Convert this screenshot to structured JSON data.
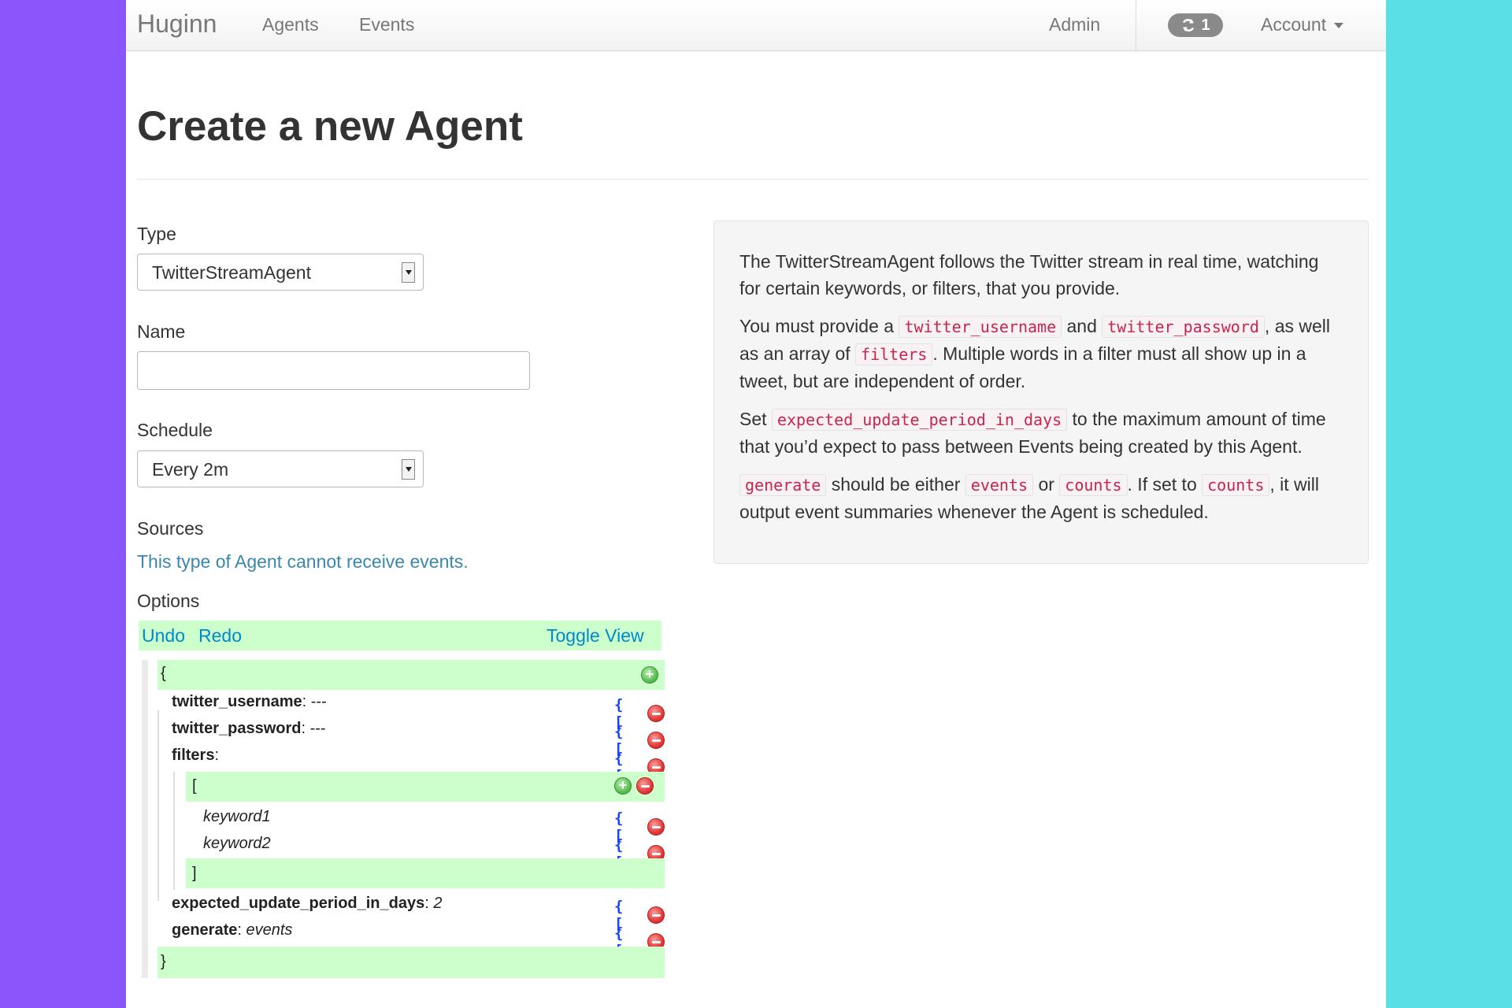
{
  "nav": {
    "brand": "Huginn",
    "agents": "Agents",
    "events": "Events",
    "admin": "Admin",
    "job_count": "1",
    "account": "Account"
  },
  "page": {
    "title": "Create a new Agent"
  },
  "form": {
    "type_label": "Type",
    "type_value": "TwitterStreamAgent",
    "name_label": "Name",
    "name_value": "",
    "schedule_label": "Schedule",
    "schedule_value": "Every 2m",
    "sources_label": "Sources",
    "sources_note": "This type of Agent cannot receive events.",
    "options_label": "Options"
  },
  "json_editor": {
    "undo": "Undo",
    "redo": "Redo",
    "toggle": "Toggle View",
    "open_brace": "{",
    "close_brace": "}",
    "open_bracket": "[",
    "close_bracket": "]",
    "type_controls": "{ [",
    "fields": [
      {
        "key": "twitter_username",
        "value": "---"
      },
      {
        "key": "twitter_password",
        "value": "---"
      },
      {
        "key": "filters",
        "value": ""
      },
      {
        "key": "expected_update_period_in_days",
        "value": "2"
      },
      {
        "key": "generate",
        "value": "events"
      }
    ],
    "filter_items": [
      "keyword1",
      "keyword2"
    ]
  },
  "description": {
    "p1": "The TwitterStreamAgent follows the Twitter stream in real time, watching for certain keywords, or filters, that you provide.",
    "p2_a": "You must provide a",
    "p2_code1": "twitter_username",
    "p2_b": "and",
    "p2_code2": "twitter_password",
    "p2_c": ", as well as an array of",
    "p2_code3": "filters",
    "p2_d": ". Multiple words in a filter must all show up in a tweet, but are independent of order.",
    "p3_a": "Set",
    "p3_code1": "expected_update_period_in_days",
    "p3_b": "to the maximum amount of time that you’d expect to pass between Events being created by this Agent.",
    "p4_code1": "generate",
    "p4_a": "should be either",
    "p4_code2": "events",
    "p4_b": "or",
    "p4_code3": "counts",
    "p4_c": ". If set to",
    "p4_code4": "counts",
    "p4_d": ", it will output event summaries whenever the Agent is scheduled."
  }
}
